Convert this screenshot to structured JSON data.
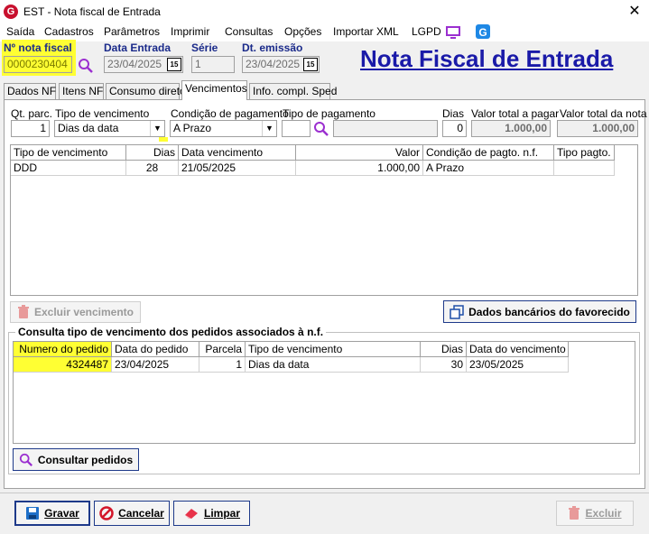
{
  "window": {
    "title": "EST - Nota fiscal de Entrada",
    "close": "✕"
  },
  "menu": [
    "Saída",
    "Cadastros",
    "Parâmetros",
    "Imprimir",
    "Consultas",
    "Opções",
    "Importar XML",
    "LGPD"
  ],
  "header": {
    "nota_label": "Nº nota fiscal",
    "nota_value": "0000230404",
    "data_entrada_label": "Data Entrada",
    "data_entrada_value": "23/04/2025",
    "serie_label": "Série",
    "serie_value": "1",
    "dt_emissao_label": "Dt. emissão",
    "dt_emissao_value": "23/04/2025",
    "cal_icon_text": "15",
    "big_title": "Nota Fiscal de Entrada"
  },
  "tabs": [
    "Dados NF",
    "Itens NF",
    "Consumo direto",
    "Vencimentos",
    "Info. compl. Sped"
  ],
  "form": {
    "qt_parc_label": "Qt. parc.",
    "qt_parc_value": "1",
    "tipo_venc_label": "Tipo de vencimento",
    "tipo_venc_value": "Dias da data",
    "cond_pag_label": "Condição de pagamento",
    "cond_pag_value": "A Prazo",
    "tipo_pag_label": "Tipo de pagamento",
    "tipo_pag_value": "",
    "tipo_pag_desc": "",
    "dias_label": "Dias",
    "dias_value": "0",
    "valor_total_pagar_label": "Valor total a pagar",
    "valor_total_pagar_value": "1.000,00",
    "valor_total_nota_label": "Valor total da nota",
    "valor_total_nota_value": "1.000,00"
  },
  "venc_table": {
    "headers": [
      "Tipo de vencimento",
      "Dias",
      "Data vencimento",
      "Valor",
      "Condição de pagto. n.f.",
      "Tipo pagto."
    ],
    "rows": [
      [
        "DDD",
        "28",
        "21/05/2025",
        "1.000,00",
        "A Prazo",
        ""
      ]
    ]
  },
  "excluir_venc_label": "Excluir vencimento",
  "dados_bancarios_label": "Dados bancários do favorecido",
  "consulta": {
    "title": "Consulta tipo de vencimento dos pedidos associados à n.f.",
    "headers": [
      "Numero do pedido",
      "Data do pedido",
      "Parcela",
      "Tipo de vencimento",
      "Dias",
      "Data do vencimento"
    ],
    "rows": [
      [
        "4324487",
        "23/04/2025",
        "1",
        "Dias da data",
        "30",
        "23/05/2025"
      ]
    ],
    "consultar_label": "Consultar pedidos"
  },
  "footer": {
    "gravar": "Gravar",
    "cancelar": "Cancelar",
    "limpar": "Limpar",
    "excluir": "Excluir"
  }
}
